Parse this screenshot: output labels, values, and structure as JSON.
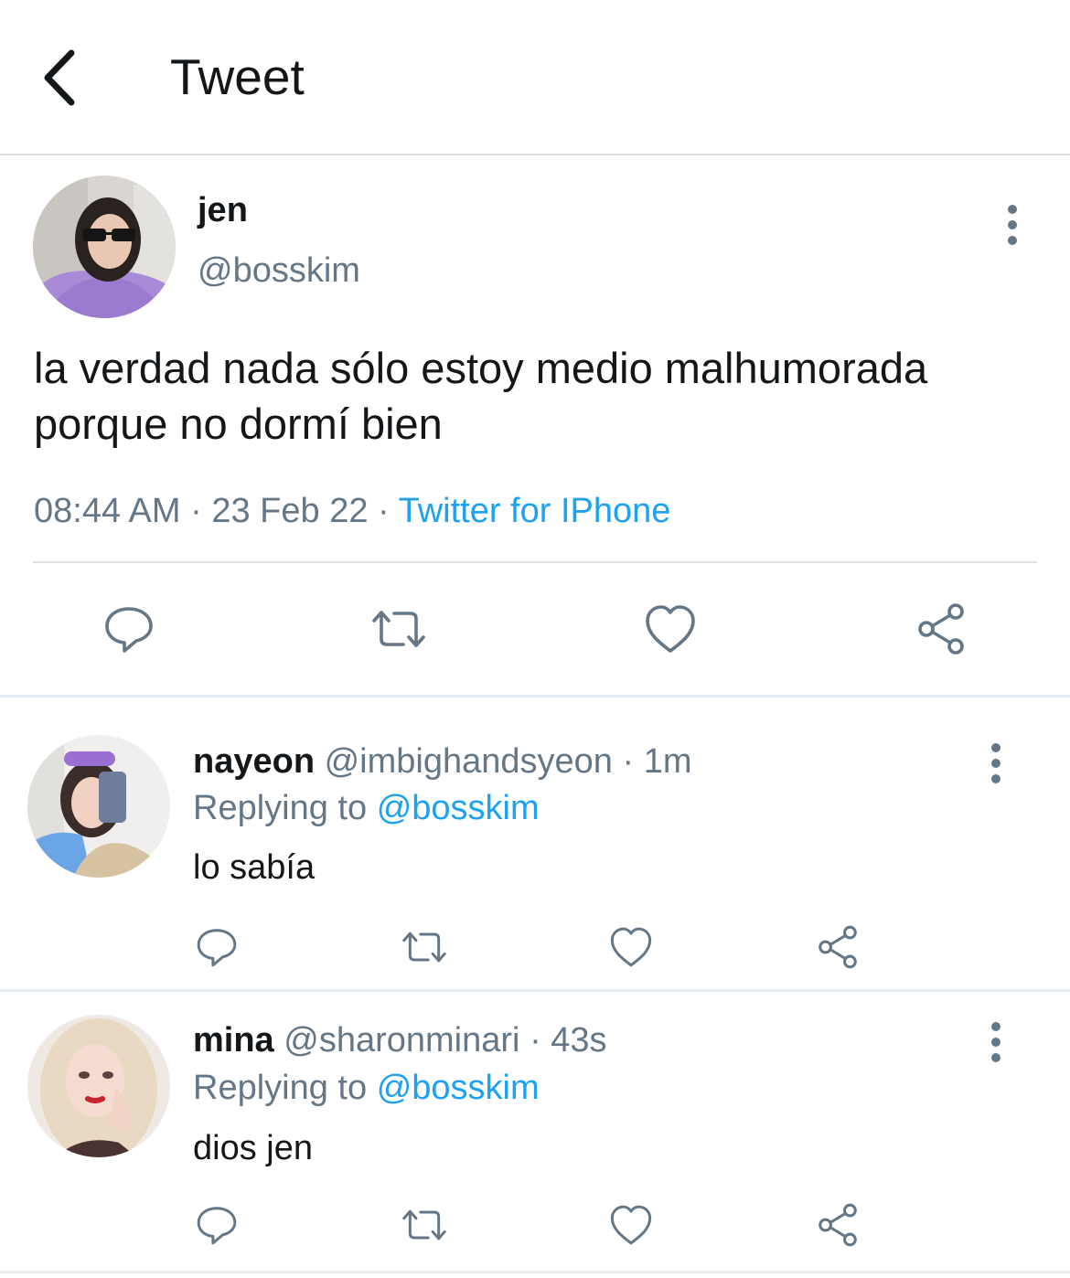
{
  "header": {
    "title": "Tweet",
    "back_icon": "chevron-left-icon"
  },
  "tweet": {
    "author_name": "jen",
    "author_handle": "@bosskim",
    "text": "la verdad nada sólo estoy medio malhumorada porque no dormí bien",
    "time": "08:44 AM",
    "dot1": "·",
    "date": "23 Feb 22",
    "dot2": "·",
    "source": "Twitter for IPhone",
    "actions": [
      "reply-icon",
      "retweet-icon",
      "like-icon",
      "share-icon"
    ]
  },
  "replies": [
    {
      "name": "nayeon",
      "handle": "@imbighandsyeon",
      "dot": "·",
      "time": "1m",
      "replying_label": "Replying to",
      "replying_handle": "@bosskim",
      "text": "lo sabía"
    },
    {
      "name": "mina",
      "handle": "@sharonminari",
      "dot": "·",
      "time": "43s",
      "replying_label": "Replying to",
      "replying_handle": "@bosskim",
      "text": "dios jen"
    }
  ],
  "colors": {
    "link": "#1da1f2",
    "muted": "#657786",
    "text": "#14171a"
  }
}
